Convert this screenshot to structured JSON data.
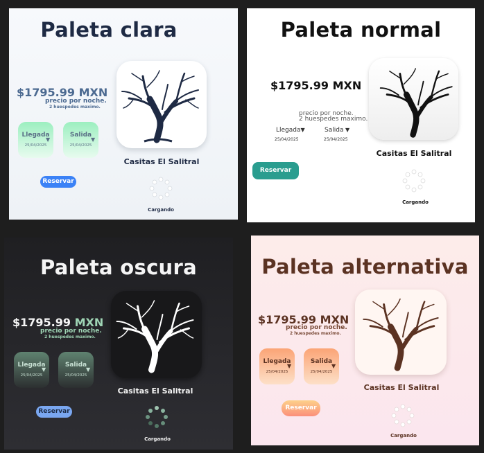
{
  "app_name": "Casitas El Salitral",
  "price_amount": "$1795.99",
  "price_currency": "MXN",
  "per_night": "precio por noche.",
  "max_guests": "2 huespedes maximo.",
  "checkin_label": "Llegada",
  "checkout_label": "Salida",
  "checkin_date": "25/04/2025",
  "checkout_date": "25/04/2025",
  "book_label": "Reservar",
  "loading_label": "Cargando",
  "panels": {
    "clara": {
      "title": "Paleta clara",
      "colors": {
        "bg": "#f3f6fa",
        "title": "#1e2a44",
        "accent": "#4c6a91",
        "tree": "#1e2a44",
        "button": "#3b82f6",
        "date_box": "#a8f0c6"
      }
    },
    "normal": {
      "title": "Paleta normal",
      "colors": {
        "bg": "#ffffff",
        "title": "#111111",
        "tree": "#111111",
        "button": "#2a9d8f"
      }
    },
    "oscura": {
      "title": "Paleta oscura",
      "colors": {
        "bg": "#27272a",
        "title": "#f5f5f5",
        "accent": "#9fd5b5",
        "tree": "#ffffff",
        "button": "#7aa7f0",
        "date_box": "#5d7e6e"
      }
    },
    "alternativa": {
      "title": "Paleta alternativa",
      "colors": {
        "bg": "#fde9ea",
        "title": "#5b3222",
        "tree": "#5b3222",
        "button": "#fca36b",
        "date_box": "#fbb98c"
      }
    }
  }
}
